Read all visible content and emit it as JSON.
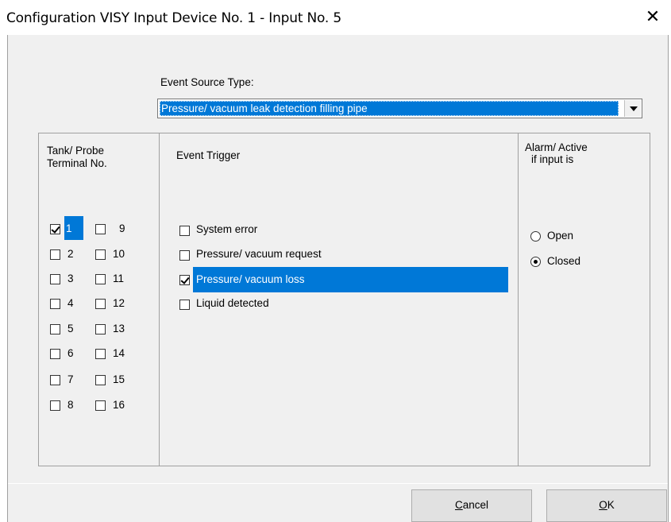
{
  "window": {
    "title": "Configuration VISY Input Device No. 1 - Input No. 5",
    "close_glyph": "✕"
  },
  "event_source": {
    "label": "Event Source Type:",
    "selected": "Pressure/ vacuum leak detection filling pipe"
  },
  "columns": {
    "tank_probe_line1": "Tank/ Probe",
    "tank_probe_line2": "Terminal No.",
    "event_trigger": "Event Trigger",
    "alarm_line1": "Alarm/ Active",
    "alarm_line2": "if input is"
  },
  "terminals": {
    "left": [
      {
        "label": "1",
        "checked": true,
        "highlighted": true
      },
      {
        "label": "2",
        "checked": false
      },
      {
        "label": "3",
        "checked": false
      },
      {
        "label": "4",
        "checked": false
      },
      {
        "label": "5",
        "checked": false
      },
      {
        "label": "6",
        "checked": false
      },
      {
        "label": "7",
        "checked": false
      },
      {
        "label": "8",
        "checked": false
      }
    ],
    "right": [
      {
        "label": "9",
        "checked": false
      },
      {
        "label": "10",
        "checked": false
      },
      {
        "label": "11",
        "checked": false
      },
      {
        "label": "12",
        "checked": false
      },
      {
        "label": "13",
        "checked": false
      },
      {
        "label": "14",
        "checked": false
      },
      {
        "label": "15",
        "checked": false
      },
      {
        "label": "16",
        "checked": false
      }
    ]
  },
  "triggers": [
    {
      "label": "System error",
      "checked": false
    },
    {
      "label": "Pressure/ vacuum request",
      "checked": false
    },
    {
      "label": "Pressure/ vacuum loss",
      "checked": true,
      "highlighted": true
    },
    {
      "label": "Liquid detected",
      "checked": false
    }
  ],
  "alarm": {
    "open_label": "Open",
    "closed_label": "Closed",
    "selected": "Closed"
  },
  "buttons": {
    "cancel_label": "Cancel",
    "ok_label": "OK"
  },
  "colors": {
    "highlight": "#0078d7",
    "dialog_bg": "#f0f0f0"
  }
}
